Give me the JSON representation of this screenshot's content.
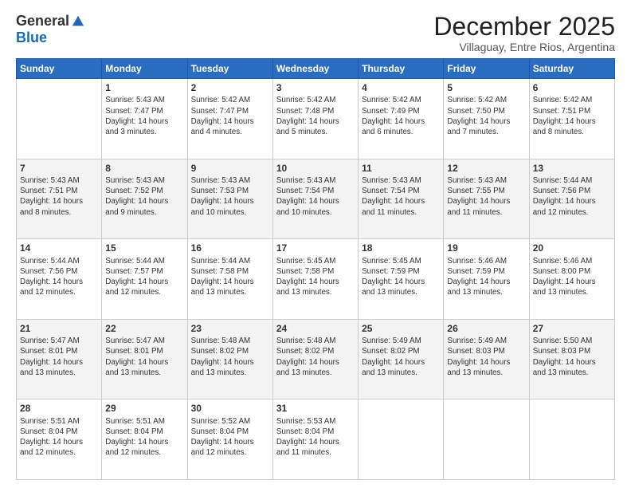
{
  "logo": {
    "general": "General",
    "blue": "Blue"
  },
  "header": {
    "title": "December 2025",
    "subtitle": "Villaguay, Entre Rios, Argentina"
  },
  "weekdays": [
    "Sunday",
    "Monday",
    "Tuesday",
    "Wednesday",
    "Thursday",
    "Friday",
    "Saturday"
  ],
  "weeks": [
    [
      {
        "day": "",
        "info": ""
      },
      {
        "day": "1",
        "info": "Sunrise: 5:43 AM\nSunset: 7:47 PM\nDaylight: 14 hours\nand 3 minutes."
      },
      {
        "day": "2",
        "info": "Sunrise: 5:42 AM\nSunset: 7:47 PM\nDaylight: 14 hours\nand 4 minutes."
      },
      {
        "day": "3",
        "info": "Sunrise: 5:42 AM\nSunset: 7:48 PM\nDaylight: 14 hours\nand 5 minutes."
      },
      {
        "day": "4",
        "info": "Sunrise: 5:42 AM\nSunset: 7:49 PM\nDaylight: 14 hours\nand 6 minutes."
      },
      {
        "day": "5",
        "info": "Sunrise: 5:42 AM\nSunset: 7:50 PM\nDaylight: 14 hours\nand 7 minutes."
      },
      {
        "day": "6",
        "info": "Sunrise: 5:42 AM\nSunset: 7:51 PM\nDaylight: 14 hours\nand 8 minutes."
      }
    ],
    [
      {
        "day": "7",
        "info": "Sunrise: 5:43 AM\nSunset: 7:51 PM\nDaylight: 14 hours\nand 8 minutes."
      },
      {
        "day": "8",
        "info": "Sunrise: 5:43 AM\nSunset: 7:52 PM\nDaylight: 14 hours\nand 9 minutes."
      },
      {
        "day": "9",
        "info": "Sunrise: 5:43 AM\nSunset: 7:53 PM\nDaylight: 14 hours\nand 10 minutes."
      },
      {
        "day": "10",
        "info": "Sunrise: 5:43 AM\nSunset: 7:54 PM\nDaylight: 14 hours\nand 10 minutes."
      },
      {
        "day": "11",
        "info": "Sunrise: 5:43 AM\nSunset: 7:54 PM\nDaylight: 14 hours\nand 11 minutes."
      },
      {
        "day": "12",
        "info": "Sunrise: 5:43 AM\nSunset: 7:55 PM\nDaylight: 14 hours\nand 11 minutes."
      },
      {
        "day": "13",
        "info": "Sunrise: 5:44 AM\nSunset: 7:56 PM\nDaylight: 14 hours\nand 12 minutes."
      }
    ],
    [
      {
        "day": "14",
        "info": "Sunrise: 5:44 AM\nSunset: 7:56 PM\nDaylight: 14 hours\nand 12 minutes."
      },
      {
        "day": "15",
        "info": "Sunrise: 5:44 AM\nSunset: 7:57 PM\nDaylight: 14 hours\nand 12 minutes."
      },
      {
        "day": "16",
        "info": "Sunrise: 5:44 AM\nSunset: 7:58 PM\nDaylight: 14 hours\nand 13 minutes."
      },
      {
        "day": "17",
        "info": "Sunrise: 5:45 AM\nSunset: 7:58 PM\nDaylight: 14 hours\nand 13 minutes."
      },
      {
        "day": "18",
        "info": "Sunrise: 5:45 AM\nSunset: 7:59 PM\nDaylight: 14 hours\nand 13 minutes."
      },
      {
        "day": "19",
        "info": "Sunrise: 5:46 AM\nSunset: 7:59 PM\nDaylight: 14 hours\nand 13 minutes."
      },
      {
        "day": "20",
        "info": "Sunrise: 5:46 AM\nSunset: 8:00 PM\nDaylight: 14 hours\nand 13 minutes."
      }
    ],
    [
      {
        "day": "21",
        "info": "Sunrise: 5:47 AM\nSunset: 8:01 PM\nDaylight: 14 hours\nand 13 minutes."
      },
      {
        "day": "22",
        "info": "Sunrise: 5:47 AM\nSunset: 8:01 PM\nDaylight: 14 hours\nand 13 minutes."
      },
      {
        "day": "23",
        "info": "Sunrise: 5:48 AM\nSunset: 8:02 PM\nDaylight: 14 hours\nand 13 minutes."
      },
      {
        "day": "24",
        "info": "Sunrise: 5:48 AM\nSunset: 8:02 PM\nDaylight: 14 hours\nand 13 minutes."
      },
      {
        "day": "25",
        "info": "Sunrise: 5:49 AM\nSunset: 8:02 PM\nDaylight: 14 hours\nand 13 minutes."
      },
      {
        "day": "26",
        "info": "Sunrise: 5:49 AM\nSunset: 8:03 PM\nDaylight: 14 hours\nand 13 minutes."
      },
      {
        "day": "27",
        "info": "Sunrise: 5:50 AM\nSunset: 8:03 PM\nDaylight: 14 hours\nand 13 minutes."
      }
    ],
    [
      {
        "day": "28",
        "info": "Sunrise: 5:51 AM\nSunset: 8:04 PM\nDaylight: 14 hours\nand 12 minutes."
      },
      {
        "day": "29",
        "info": "Sunrise: 5:51 AM\nSunset: 8:04 PM\nDaylight: 14 hours\nand 12 minutes."
      },
      {
        "day": "30",
        "info": "Sunrise: 5:52 AM\nSunset: 8:04 PM\nDaylight: 14 hours\nand 12 minutes."
      },
      {
        "day": "31",
        "info": "Sunrise: 5:53 AM\nSunset: 8:04 PM\nDaylight: 14 hours\nand 11 minutes."
      },
      {
        "day": "",
        "info": ""
      },
      {
        "day": "",
        "info": ""
      },
      {
        "day": "",
        "info": ""
      }
    ]
  ]
}
